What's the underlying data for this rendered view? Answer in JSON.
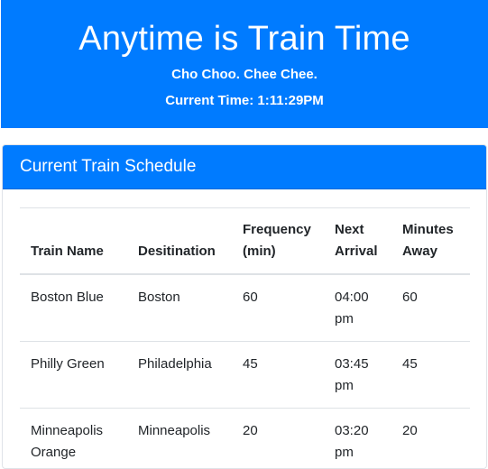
{
  "header": {
    "title": "Anytime is Train Time",
    "subtitle": "Cho Choo. Chee Chee.",
    "current_time": "Current Time: 1:11:29PM"
  },
  "schedule": {
    "title": "Current Train Schedule",
    "columns": [
      "Train Name",
      "Desitination",
      "Frequency (min)",
      "Next Arrival",
      "Minutes Away"
    ],
    "rows": [
      {
        "name": "Boston Blue",
        "destination": "Boston",
        "frequency": "60",
        "next_arrival": "04:00 pm",
        "minutes_away": "60"
      },
      {
        "name": "Philly Green",
        "destination": "Philadelphia",
        "frequency": "45",
        "next_arrival": "03:45 pm",
        "minutes_away": "45"
      },
      {
        "name": "Minneapolis Orange",
        "destination": "Minneapolis",
        "frequency": "20",
        "next_arrival": "03:20 pm",
        "minutes_away": "20"
      }
    ]
  },
  "colors": {
    "primary": "#007bff",
    "text": "#212529",
    "border": "#dee2e6"
  }
}
